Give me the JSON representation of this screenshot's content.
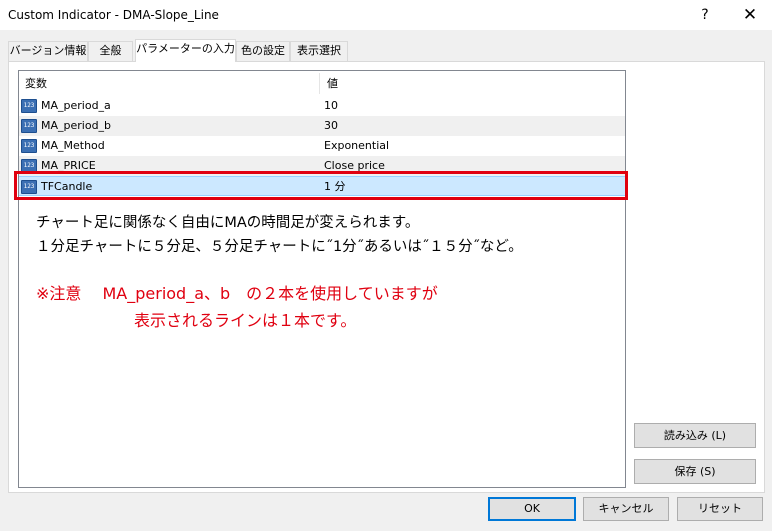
{
  "window": {
    "title": "Custom Indicator - DMA-Slope_Line",
    "help": "?",
    "close": "✕"
  },
  "tabs": [
    {
      "label": "バージョン情報"
    },
    {
      "label": "全般"
    },
    {
      "label": "パラメーターの入力"
    },
    {
      "label": "色の設定"
    },
    {
      "label": "表示選択"
    }
  ],
  "grid": {
    "headers": {
      "variable": "変数",
      "value": "値"
    },
    "icon_text": "123",
    "rows": [
      {
        "name": "MA_period_a",
        "value": "10"
      },
      {
        "name": "MA_period_b",
        "value": "30"
      },
      {
        "name": "MA_Method",
        "value": "Exponential"
      },
      {
        "name": "MA_PRICE",
        "value": "Close price"
      },
      {
        "name": "TFCandle",
        "value": "1 分"
      }
    ]
  },
  "annotation": {
    "line1": "チャート足に関係なく自由にMAの時間足が変えられます。",
    "line2": "１分足チャートに５分足、５分足チャートに˝1分˝あるいは˝１５分˝など。",
    "warn1": "※注意　 MA_period_a、b　の２本を使用していますが",
    "warn2": "表示されるラインは１本です。"
  },
  "buttons": {
    "load": "読み込み (L)",
    "save": "保存 (S)",
    "ok": "OK",
    "cancel": "キャンセル",
    "reset": "リセット"
  },
  "colors": {
    "highlight_border": "#e0000f",
    "annotation_red": "#e00010",
    "selection": "#cce8ff"
  }
}
